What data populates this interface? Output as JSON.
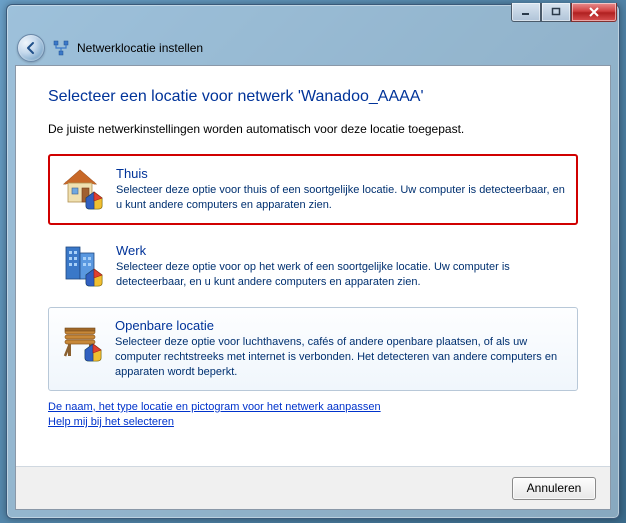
{
  "window": {
    "header_title": "Netwerklocatie instellen"
  },
  "page": {
    "title": "Selecteer een locatie voor netwerk 'Wanadoo_AAAA'",
    "subtitle": "De juiste netwerkinstellingen worden automatisch voor deze locatie toegepast."
  },
  "options": {
    "home": {
      "title": "Thuis",
      "desc": "Selecteer deze optie voor thuis of een soortgelijke locatie. Uw computer is detecteerbaar, en u kunt andere computers en apparaten zien."
    },
    "work": {
      "title": "Werk",
      "desc": "Selecteer deze optie voor op het werk of een soortgelijke locatie. Uw computer is detecteerbaar, en u kunt andere computers en apparaten zien."
    },
    "public": {
      "title": "Openbare locatie",
      "desc": "Selecteer deze optie voor luchthavens, cafés of andere openbare plaatsen, of als uw computer rechtstreeks met internet is verbonden. Het detecteren van andere computers en apparaten wordt beperkt."
    }
  },
  "links": {
    "customize": "De naam, het type locatie en pictogram voor het netwerk aanpassen",
    "help": "Help mij bij het selecteren"
  },
  "buttons": {
    "cancel": "Annuleren"
  }
}
